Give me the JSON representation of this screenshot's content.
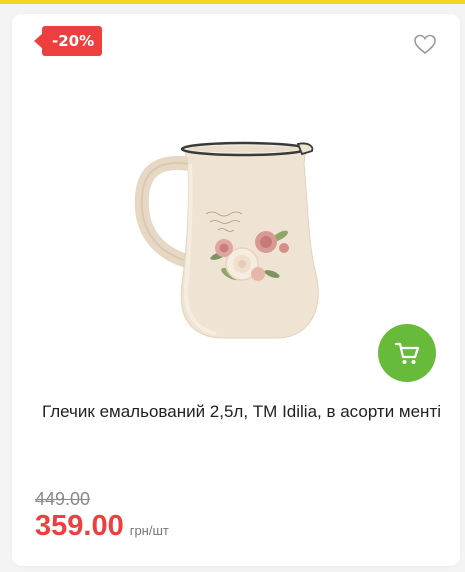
{
  "badge": {
    "discount": "-20%"
  },
  "product": {
    "title": "Глечик емальований 2,5л, ТМ Idilia, в асорти менті",
    "old_price": "449.00",
    "price": "359.00",
    "unit": "грн/шт"
  },
  "icons": {
    "wishlist": "heart-icon",
    "cart": "cart-icon"
  },
  "colors": {
    "accent_strip": "#f5d321",
    "discount_red": "#ee3f3f",
    "cart_green": "#68ba3a"
  }
}
